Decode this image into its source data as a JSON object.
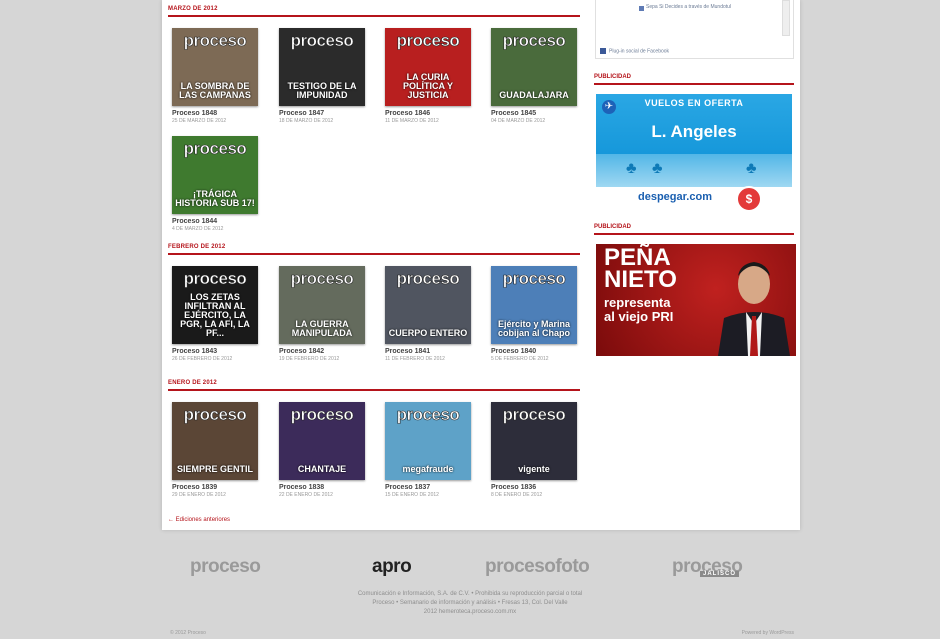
{
  "sections": [
    {
      "title": "MARZO DE 2012",
      "issues": [
        {
          "name": "Proceso 1848",
          "date": "25 DE MARZO DE 2012",
          "headline": "LA SOMBRA DE LAS CAMPANAS",
          "bg": "#7d6a55"
        },
        {
          "name": "Proceso 1847",
          "date": "18 DE MARZO DE 2012",
          "headline": "TESTIGO DE LA IMPUNIDAD",
          "bg": "#2b2b2b"
        },
        {
          "name": "Proceso 1846",
          "date": "11 DE MARZO DE 2012",
          "headline": "LA CURIA POLÍTICA Y JUSTICIA",
          "bg": "#b81f1f"
        },
        {
          "name": "Proceso 1845",
          "date": "04 DE MARZO DE 2012",
          "headline": "GUADALAJARA",
          "bg": "#4a6b3c"
        },
        {
          "name": "Proceso 1844",
          "date": "4 DE MARZO DE 2012",
          "headline": "¡TRÁGICA HISTORIA SUB 17!",
          "bg": "#3f7a2f"
        }
      ]
    },
    {
      "title": "FEBRERO DE 2012",
      "issues": [
        {
          "name": "Proceso 1843",
          "date": "26 DE FEBRERO DE 2012",
          "headline": "LOS ZETAS INFILTRAN AL EJÉRCITO, LA PGR, LA AFI, LA PF...",
          "bg": "#1a1a1a"
        },
        {
          "name": "Proceso 1842",
          "date": "19 DE FEBRERO DE 2012",
          "headline": "LA GUERRA MANIPULADA",
          "bg": "#646b5d"
        },
        {
          "name": "Proceso 1841",
          "date": "11 DE FEBRERO DE 2012",
          "headline": "CUERPO ENTERO",
          "bg": "#505560"
        },
        {
          "name": "Proceso 1840",
          "date": "5 DE FEBRERO DE 2012",
          "headline": "Ejército y Marina cobijan al Chapo",
          "bg": "#4d7fb8"
        }
      ]
    },
    {
      "title": "ENERO DE 2012",
      "issues": [
        {
          "name": "Proceso 1839",
          "date": "29 DE ENERO DE 2012",
          "headline": "SIEMPRE GENTIL",
          "bg": "#5b4636"
        },
        {
          "name": "Proceso 1838",
          "date": "22 DE ENERO DE 2012",
          "headline": "CHANTAJE",
          "bg": "#3c2b5a"
        },
        {
          "name": "Proceso 1837",
          "date": "15 DE ENERO DE 2012",
          "headline": "megafraude",
          "bg": "#5ea2c8"
        },
        {
          "name": "Proceso 1836",
          "date": "8 DE ENERO DE 2012",
          "headline": "vigente",
          "bg": "#2d2d3a"
        }
      ]
    }
  ],
  "cover_masthead": "proceso",
  "more_link": "← Ediciones anteriores",
  "sidebar": {
    "fb_text": "Sepa Si Decides a través de Mundotul",
    "fb_plugin": "Plug-in social de Facebook",
    "ad_label_1": "PUBLICIDAD",
    "ad_label_2": "PUBLICIDAD",
    "ad1": {
      "top": "VUELOS EN OFERTA",
      "city": "L. Angeles",
      "brand": "despegar.com",
      "coin": "$"
    },
    "ad2": {
      "line1": "PEÑA",
      "line2": "NIETO",
      "line3": "representa",
      "line4": "al viejo PRI"
    }
  },
  "footer": {
    "logos": [
      {
        "id": "proceso",
        "text": "proceso"
      },
      {
        "id": "apro",
        "text": "apro"
      },
      {
        "id": "procesofoto",
        "text": "procesofoto"
      },
      {
        "id": "proceso-jalisco",
        "text": "proceso",
        "sub": "JALISCO"
      }
    ],
    "line1": "Comunicación e Información, S.A. de C.V. • Prohibida su reproducción parcial o total",
    "line2": "Proceso • Semanario de información y análisis • Fresas 13, Col. Del Valle",
    "line3": "2012 hemeroteca.proceso.com.mx",
    "copyright": "© 2012 Proceso",
    "powered": "Powered by WordPress"
  },
  "colors": {
    "accent": "#b5141b",
    "page_bg": "#d6d6d6"
  }
}
